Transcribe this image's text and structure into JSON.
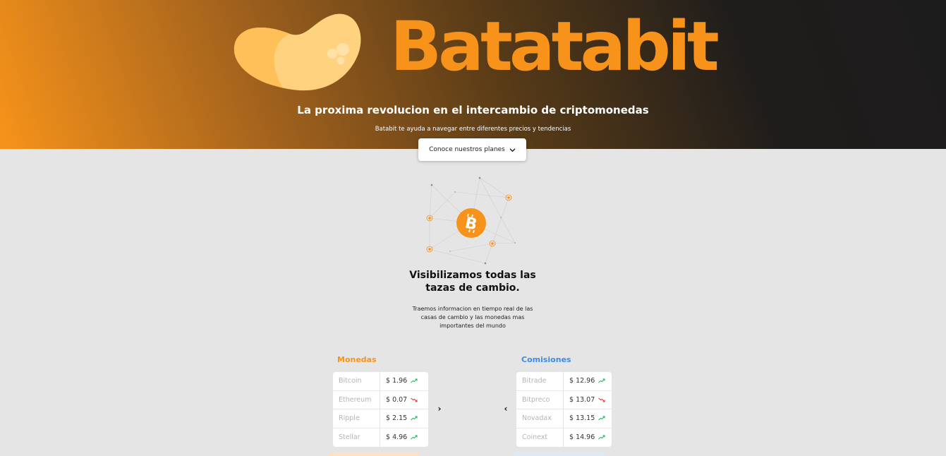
{
  "hero": {
    "brand": "Batatabit",
    "tagline": "La proxima revolucion en el intercambio de criptomonedas",
    "subtitle": "Batabit te ayuda a navegar entre diferentes precios y tendencias",
    "plans_button": "Conoce nuestros planes",
    "gradient_colors": [
      "#f7931a",
      "#1f1d1b"
    ]
  },
  "colors": {
    "brand_orange": "#f7931a",
    "commission_blue": "#3c8be6",
    "trend_up": "#18b558",
    "trend_down": "#e0312e"
  },
  "info": {
    "icon": "bitcoin-network-icon",
    "title_line1": "Visibilizamos todas las",
    "title_line2": "tazas de cambio.",
    "desc_line1": "Traemos informacion en tiempo real de las",
    "desc_line2": "casas de cambio y las monedas mas",
    "desc_line3": "importantes del mundo"
  },
  "monedas": {
    "label": "Monedas",
    "rows": [
      {
        "name": "Bitcoin",
        "value": "$ 1.96",
        "trend": "up"
      },
      {
        "name": "Ethereum",
        "value": "$ 0.07",
        "trend": "down"
      },
      {
        "name": "Ripple",
        "value": "$ 2.15",
        "trend": "up"
      },
      {
        "name": "Stellar",
        "value": "$ 4.96",
        "trend": "up"
      }
    ]
  },
  "comisiones": {
    "label": "Comisiones",
    "rows": [
      {
        "name": "Bitrade",
        "value": "$ 12.96",
        "trend": "up"
      },
      {
        "name": "Bitpreco",
        "value": "$ 13.07",
        "trend": "down"
      },
      {
        "name": "Novadax",
        "value": "$ 13.15",
        "trend": "up"
      },
      {
        "name": "Coinext",
        "value": "$ 14.96",
        "trend": "up"
      }
    ]
  },
  "arrows": {
    "next": "›",
    "prev": "‹"
  }
}
